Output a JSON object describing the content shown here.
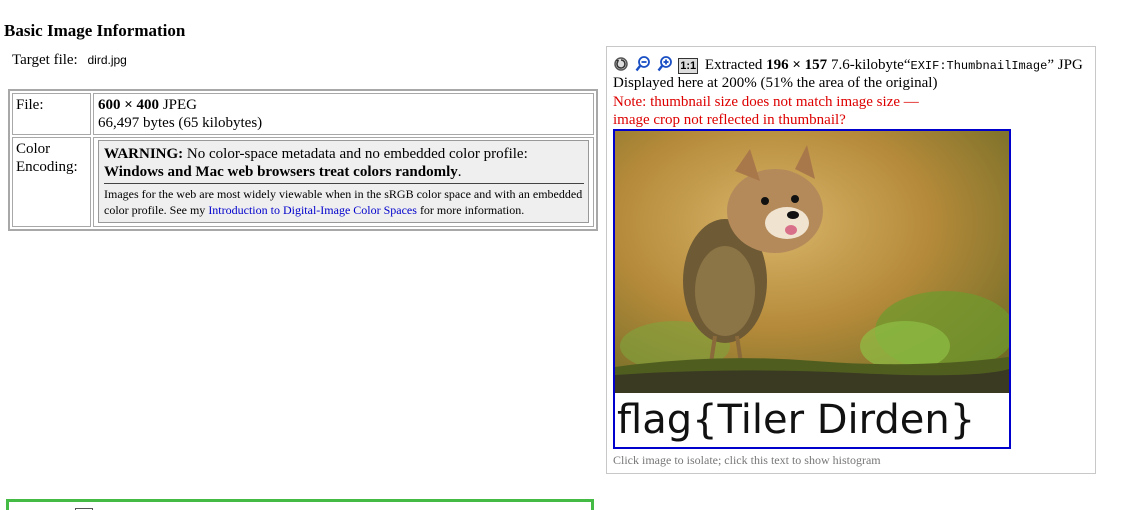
{
  "heading": "Basic Image Information",
  "target": {
    "label": "Target file:",
    "filename": "dird.jpg"
  },
  "info_table": {
    "file_label": "File:",
    "file_dims": "600 × 400",
    "file_type": "JPEG",
    "file_bytes": "66,497 bytes (65 kilobytes)",
    "color_label_1": "Color",
    "color_label_2": "Encoding:",
    "warning_bold": "WARNING:",
    "warning_text": "No color-space metadata and no embedded color profile:",
    "warning_line2": "Windows and Mac web browsers treat colors randomly",
    "warning_line2_end": ".",
    "note_prefix": "Images for the web are most widely viewable when in the sRGB color space and with an embedded color profile. See my",
    "note_link": "Introduction to Digital-Image Color Spaces",
    "note_suffix": "for more information."
  },
  "thumb_panel": {
    "toolbar_icons": [
      "rotate-icon",
      "zoom-out-icon",
      "zoom-in-icon",
      "actual-size-icon"
    ],
    "actual_size_label": "1:1",
    "extracted_prefix": "Extracted",
    "extracted_dims": "196 × 157",
    "extracted_size": "7.6-kilobyte",
    "open_quote": "“",
    "exif_tag": "EXIF:ThumbnailImage",
    "close_quote": "”",
    "format": "JPG",
    "displayed_line": "Displayed here at 200% (51% the area of the original)",
    "note": "Note: thumbnail size does not match image size — image crop not reflected in thumbnail?",
    "flag_text": "flag{Tiler Dirden}",
    "caption": "Click image to isolate; click this text to show histogram"
  },
  "colors": {
    "link": "#0000cc",
    "note_red": "#dd0000",
    "thumb_border": "#0000cc",
    "green_border": "#44bb44"
  }
}
